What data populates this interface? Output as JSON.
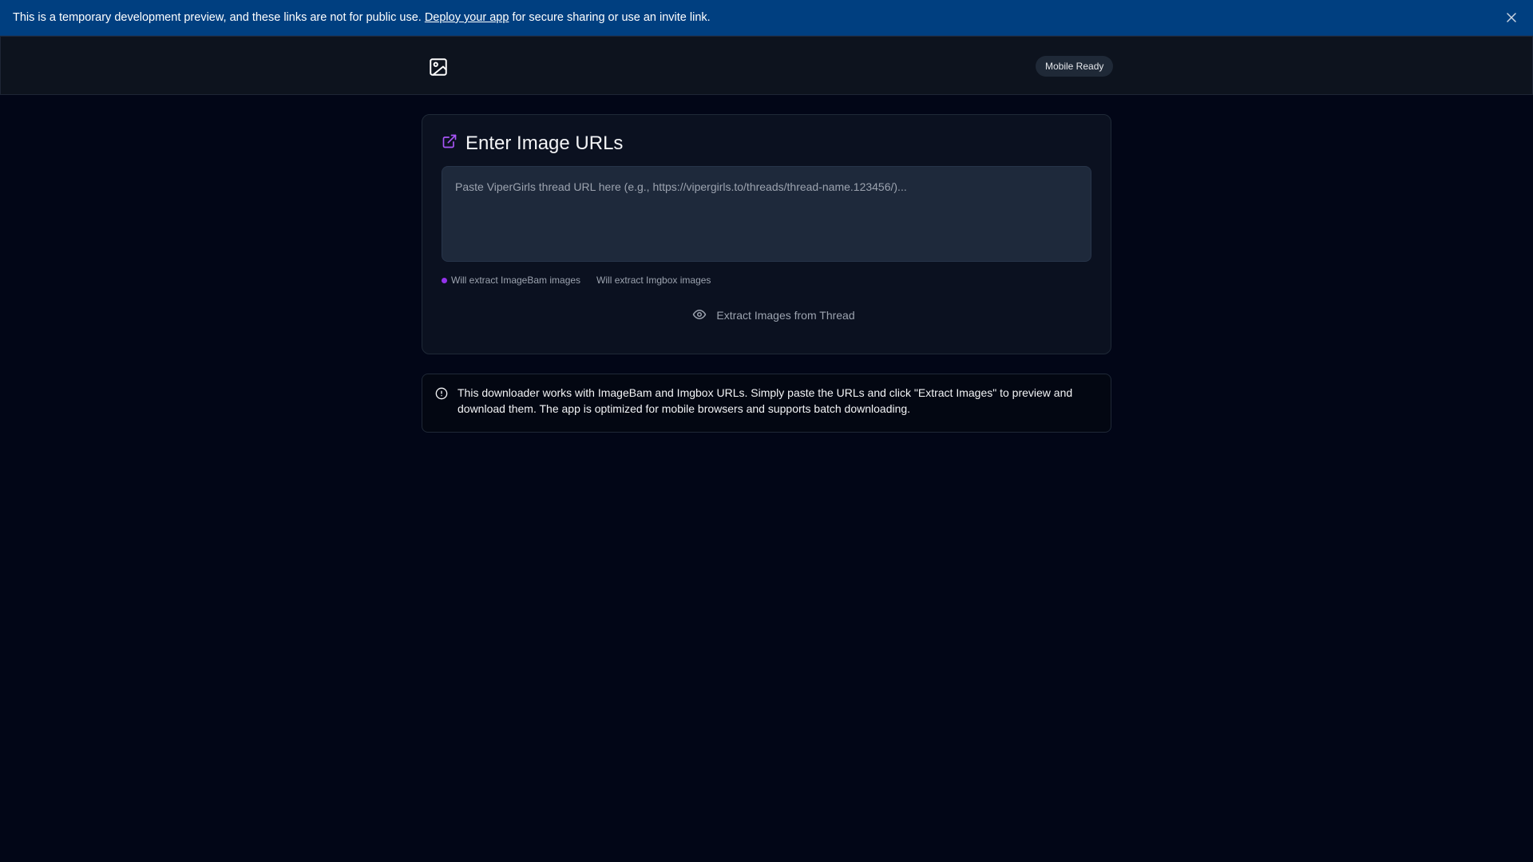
{
  "banner": {
    "text_before": "This is a temporary development preview, and these links are not for public use. ",
    "link": "Deploy your app",
    "text_after": " for secure sharing or use an invite link."
  },
  "header": {
    "badge": "Mobile Ready",
    "logo_icon": "image-icon"
  },
  "card": {
    "title": "Enter Image URLs",
    "title_icon": "external-link-icon",
    "textarea_value": "",
    "textarea_placeholder": "Paste ViperGirls thread URL here (e.g., https://vipergirls.to/threads/thread-name.123456/)...",
    "hints": [
      "Will extract ImageBam images",
      "Will extract Imgbox images"
    ],
    "button_label": "Extract Images from Thread",
    "button_icon": "eye-icon"
  },
  "info": {
    "icon": "alert-circle-icon",
    "text": "This downloader works with ImageBam and Imgbox URLs. Simply paste the URLs and click \"Extract Images\" to preview and download them. The app is optimized for mobile browsers and supports batch downloading."
  },
  "colors": {
    "background": "#020617",
    "banner": "#003f80",
    "accent": "#9333ea"
  }
}
